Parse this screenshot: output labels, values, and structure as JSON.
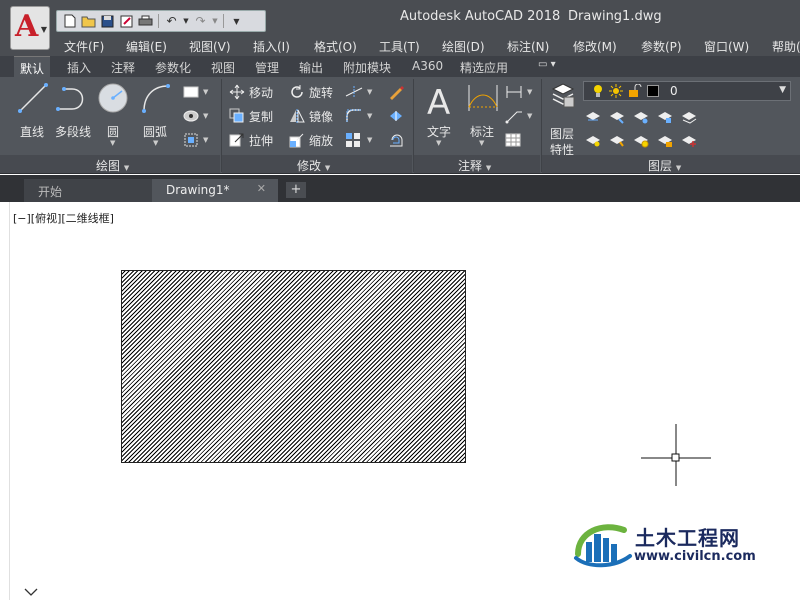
{
  "window": {
    "app_title": "Autodesk AutoCAD 2018",
    "document_title": "Drawing1.dwg",
    "app_logo": "A"
  },
  "quick_access": [
    "new-icon",
    "open-icon",
    "save-icon",
    "saveas-icon",
    "print-icon",
    "undo-icon",
    "redo-icon",
    "customize-icon"
  ],
  "menu": [
    {
      "id": "file",
      "label": "文件(F)"
    },
    {
      "id": "edit",
      "label": "编辑(E)"
    },
    {
      "id": "view",
      "label": "视图(V)"
    },
    {
      "id": "insert",
      "label": "插入(I)"
    },
    {
      "id": "format",
      "label": "格式(O)"
    },
    {
      "id": "tools",
      "label": "工具(T)"
    },
    {
      "id": "draw",
      "label": "绘图(D)"
    },
    {
      "id": "dimension",
      "label": "标注(N)"
    },
    {
      "id": "modify",
      "label": "修改(M)"
    },
    {
      "id": "params",
      "label": "参数(P)"
    },
    {
      "id": "window",
      "label": "窗口(W)"
    },
    {
      "id": "help",
      "label": "帮助("
    }
  ],
  "ribbon_tabs": [
    {
      "id": "default",
      "label": "默认",
      "active": true
    },
    {
      "id": "insert",
      "label": "插入"
    },
    {
      "id": "annotate",
      "label": "注释"
    },
    {
      "id": "parametric",
      "label": "参数化"
    },
    {
      "id": "view",
      "label": "视图"
    },
    {
      "id": "manage",
      "label": "管理"
    },
    {
      "id": "output",
      "label": "输出"
    },
    {
      "id": "addins",
      "label": "附加模块"
    },
    {
      "id": "a360",
      "label": "A360"
    },
    {
      "id": "featured",
      "label": "精选应用"
    }
  ],
  "panels": {
    "draw": {
      "title": "绘图",
      "line": "直线",
      "polyline": "多段线",
      "circle": "圆",
      "arc": "圆弧"
    },
    "modify": {
      "title": "修改",
      "move": "移动",
      "rotate": "旋转",
      "copy": "复制",
      "mirror": "镜像",
      "stretch": "拉伸",
      "scale": "缩放"
    },
    "annotation": {
      "title": "注释",
      "text": "文字",
      "dimension": "标注"
    },
    "layers": {
      "title": "图层",
      "properties_line1": "图层",
      "properties_line2": "特性",
      "current_layer": "0"
    }
  },
  "doc_tabs": {
    "start": "开始",
    "drawing": "Drawing1*",
    "close": "✕",
    "add": "+"
  },
  "viewport": {
    "label": "[−][俯视][二维线框]"
  },
  "watermark": {
    "name": "土木工程网",
    "url": "www.civilcn.com"
  },
  "colors": {
    "ribbon_bg": "#52565c",
    "title_bg": "#4a4d52",
    "accent_red": "#c8202a",
    "watermark_blue": "#1b2a5e",
    "watermark_green": "#6cb33f"
  }
}
